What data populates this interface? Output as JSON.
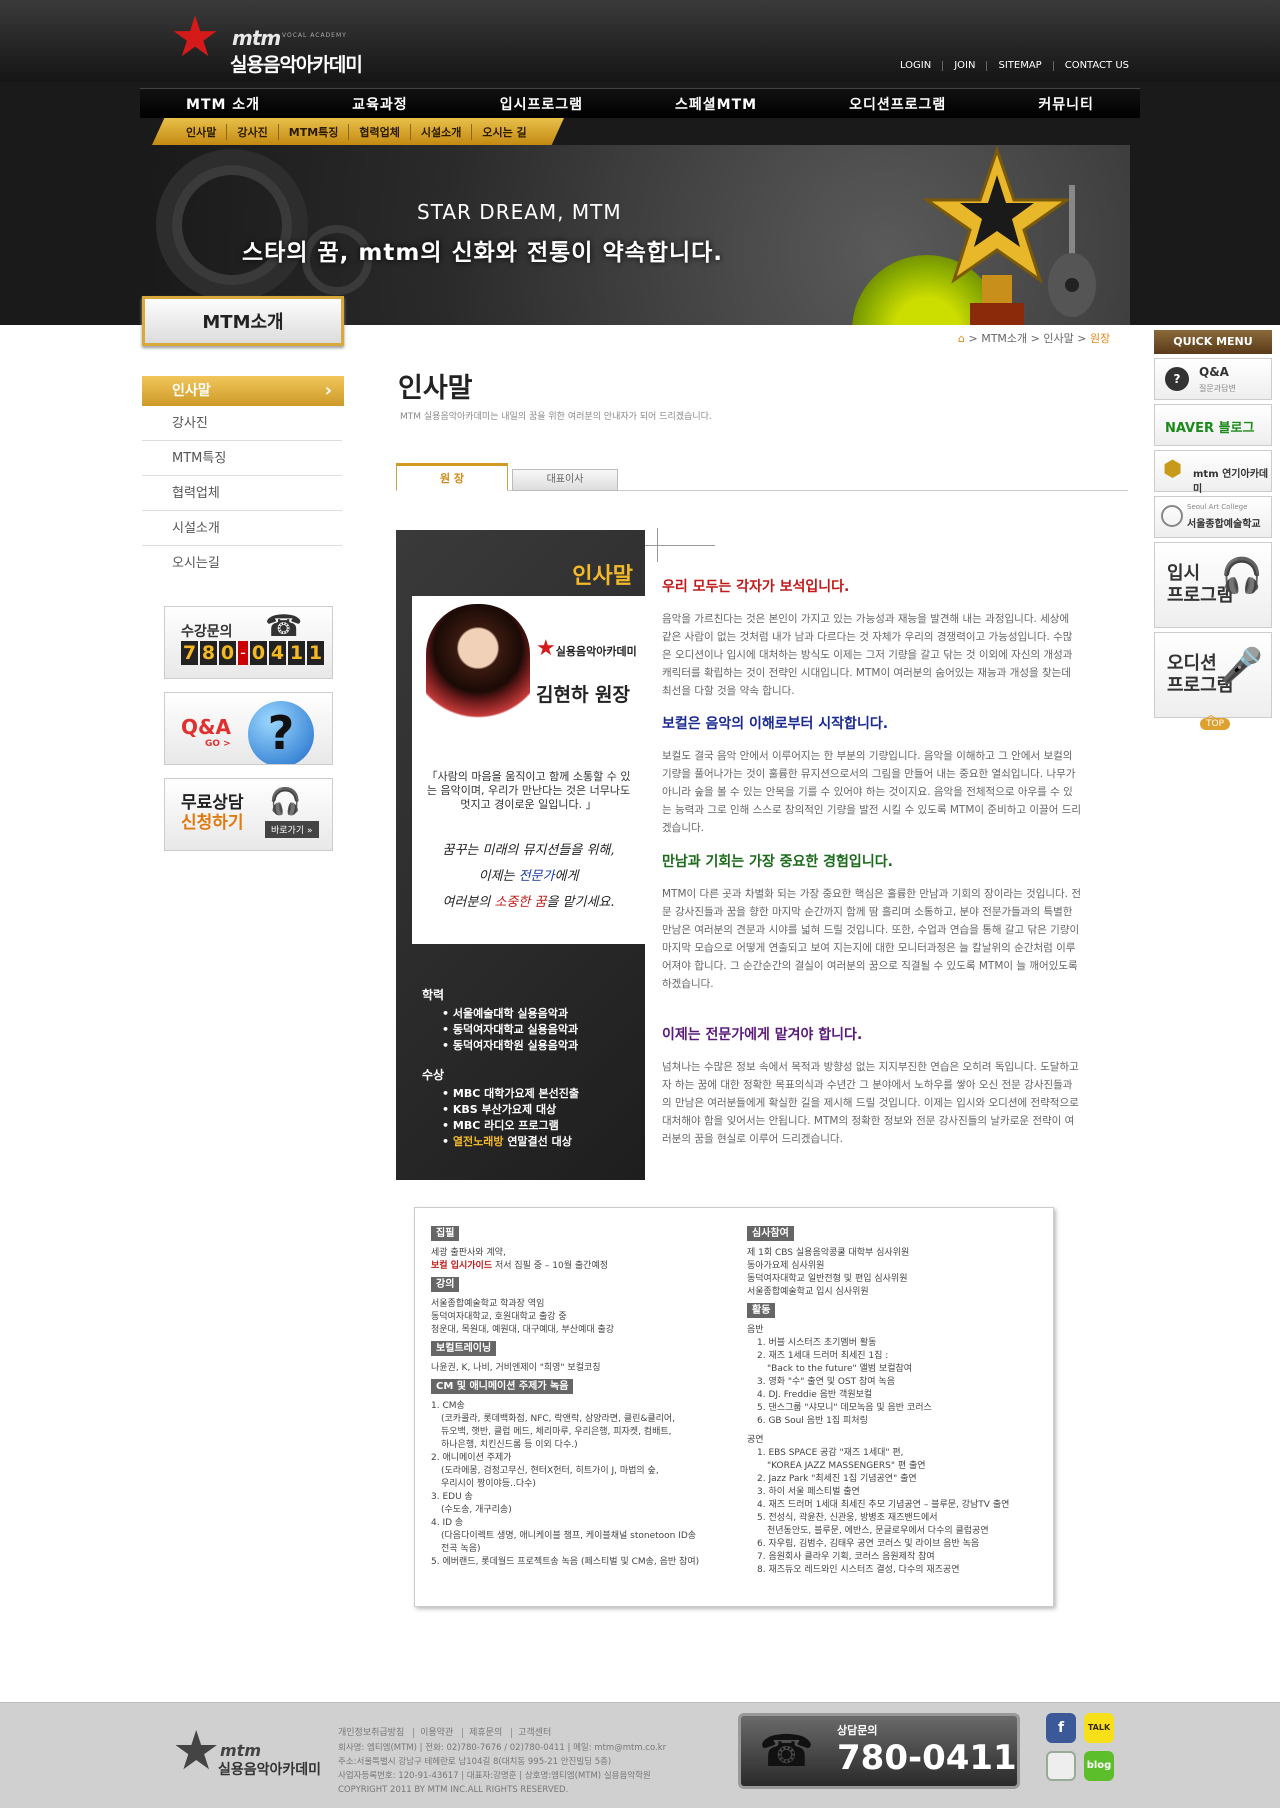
{
  "header": {
    "logo_mtm": "mtm",
    "logo_sub": "VOCAL ACADEMY",
    "logo_kr": "실용음악아카데미",
    "top_links": [
      "LOGIN",
      "JOIN",
      "SITEMAP",
      "CONTACT US"
    ],
    "gnb": [
      "MTM 소개",
      "교육과정",
      "입시프로그램",
      "스페셜MTM",
      "오디션프로그램",
      "커뮤니티"
    ],
    "subnav": [
      "인사말",
      "강사진",
      "MTM특징",
      "협력업체",
      "시설소개",
      "오시는 길"
    ],
    "banner_en": "STAR DREAM, MTM",
    "banner_kr": "스타의 꿈, mtm의 신화와 전통이 약속합니다."
  },
  "sidebar": {
    "title": "MTM소개",
    "items": [
      "인사말",
      "강사진",
      "MTM특징",
      "협력업체",
      "시설소개",
      "오시는길"
    ],
    "contact_label": "수강문의",
    "contact_num1": [
      "7",
      "8",
      "0"
    ],
    "contact_num2": [
      "0",
      "4",
      "1",
      "1"
    ],
    "qa_label": "Q&A",
    "qa_go": "GO >",
    "free_line1": "무료상담",
    "free_line2": "신청하기",
    "free_go": "바로가기 »"
  },
  "breadcrumb": {
    "items": [
      "MTM소개",
      "인사말"
    ],
    "current": "원장"
  },
  "content": {
    "title": "인사말",
    "desc": "MTM 실용음악아카데미는 내일의 꿈을 위한 여러분의 안내자가 되어 드리겠습니다.",
    "tab_active": "원 장",
    "tab_other": "대표이사"
  },
  "panel": {
    "title": "인사말",
    "logo_text": "실용음악아카데미",
    "name": "김현하 원장",
    "quote": "「사람의 마음을 움직이고 함께 소통할 수 있는 음악이며, 우리가 만난다는 것은 너무나도 멋지고 경이로운 일입니다. 」",
    "hand1": "꿈꾸는 미래의 뮤지션들을 위해,",
    "hand2a": "이제는 ",
    "hand2b": "전문가",
    "hand2c": "에게",
    "hand3a": "여러분의 ",
    "hand3b": "소중한 꿈",
    "hand3c": "을 맡기세요.",
    "edu_title": "학력",
    "edu": [
      "서울예술대학 실용음악과",
      "동덕여자대학교 실용음악과",
      "동덕여자대학원 실용음악과"
    ],
    "award_title": "수상",
    "awards": [
      "MBC 대학가요제 본선진출",
      "KBS 부산가요제 대상",
      "MBC 라디오 프로그램"
    ],
    "award_last_y": "열전노래방",
    "award_last": " 연말결선 대상"
  },
  "body": {
    "s1_title": "우리 모두는 각자가 보석입니다.",
    "s1_color": "#c01a1a",
    "s1_text": "음악을 가르친다는 것은 본인이 가지고 있는 가능성과 재능을 발견해 내는 과정입니다. 세상에 같은 사람이 없는 것처럼 내가 남과 다르다는 것 자체가 우리의 경쟁력이고 가능성입니다. 수많은 오디션이나 입시에 대처하는 방식도 이제는 그저 기량을 갈고 닦는 것 이외에 자신의 개성과 캐릭터를 확립하는 것이 전략인 시대입니다. MTM이 여러분의 숨어있는 재능과 개성을 찾는데 최선을 다할 것을 약속 합니다.",
    "s2_title": "보컬은 음악의 이해로부터 시작합니다.",
    "s2_color": "#1a2a90",
    "s2_text": "보컬도 결국 음악 안에서 이루어지는 한 부분의 기량입니다. 음악을 이해하고 그 안에서 보컬의 기량을 풀어나가는 것이 훌륭한 뮤지션으로서의 그림을 만들어 내는 중요한 열쇠입니다. 나무가 아니라 숲을 볼 수 있는 안목을 기를 수 있어야 하는 것이지요. 음악을 전체적으로 아우를 수 있는 능력과 그로 인해 스스로 창의적인 기량을 발전 시킬 수 있도록 MTM이 준비하고 이끌어 드리겠습니다.",
    "s3_title": "만남과 기회는 가장 중요한 경험입니다.",
    "s3_color": "#1a6a1a",
    "s3_text": "MTM이 다른 곳과 차별화 되는 가장 중요한 핵심은 훌륭한 만남과 기회의 장이라는 것입니다. 전문 강사진들과 꿈을 향한 마지막 순간까지 함께 땀 흘리며 소통하고, 분야 전문가들과의 특별한 만남은 여러분의 견문과 시야를 넓혀 드릴 것입니다. 또한, 수업과 연습을 통해 갈고 닦은 기량이 마지막 모습으로 어떻게 연출되고 보여 지는지에 대한 모니터과정은 늘 칼날위의 순간처럼 이루어져야 합니다. 그 순간순간의 결실이 여러분의 꿈으로 직결될 수 있도록 MTM이 늘 깨어있도록 하겠습니다.",
    "s4_title": "이제는 전문가에게 맡겨야 합니다.",
    "s4_color": "#5a1a7a",
    "s4_text": "넘쳐나는 수많은 정보 속에서 목적과 방향성 없는 지지부진한 연습은 오히려 독입니다. 도달하고자 하는 꿈에 대한 정확한 목표의식과 수년간 그 분야에서 노하우를 쌓아 오신 전문 강사진들과의 만남은 여러분들에게 확실한 길을 제시해 드릴 것입니다. 이제는 입시와 오디션에 전략적으로 대처해야 함을 잊어서는 안됩니다. MTM의 정확한 정보와 전문 강사진들의 날카로운 전략이 여러분의 꿈을 현실로 이루어 드리겠습니다."
  },
  "history": {
    "l1": "집필",
    "l1_text1": "세광 출판사와 계약,",
    "l1_red": "보컬 입시가이드",
    "l1_text2": " 저서 집필 중 – 10월 출간예정",
    "l2": "강의",
    "l2_lines": [
      "서울종합예술학교 학과장 역임",
      "동덕여자대학교, 호원대학교 출강 중",
      "청운대, 목원대, 예원대, 대구예대, 부산예대 출강"
    ],
    "l3": "보컬트레이닝",
    "l3_text": "나윤권, K, 나비, 거비엔제이 \"희영\" 보컬코칭",
    "l4": "CM 및 애니메이션 주제가 녹음",
    "l4_lines": [
      "1. CM송",
      "(코카콜라, 롯데백화점, NFC, 락앤락, 삼양라면, 클린&클리어,",
      "듀오백, 햇반, 클럽 메드, 체리마루, 우리은행, 피자켓, 컴배트,",
      "하나은행, 치킨신드롬 등 이외 다수.)",
      "2. 애니메이션 주제가",
      "(도라에몽, 검정고무신, 현터X헌터, 히트가이 J, 마법의 숲,",
      "우리시이 짱이야등..다수)",
      "3. EDU 송",
      "(수도송, 개구리송)",
      "4. ID 송",
      "(다음다이렉트 생명, 애니케이블 챔프, 케이블채널 stonetoon ID송",
      "전곡 녹음)",
      "5. 에버랜드, 롯데월드 프로젝트송 녹음 (페스티벌 및 CM송, 음반 참여)"
    ],
    "r1": "심사참여",
    "r1_lines": [
      "제 1회 CBS 실용음악콩쿨 대학부 심사위원",
      "동아가요제 심사위원",
      "동덕여자대학교 일반전형 및 편입 심사위원",
      "서울종합예술학교 입시 심사위원"
    ],
    "r2": "활동",
    "r2_sub1": "음반",
    "r2_album": [
      "1. 버블 시스터즈 초기멤버 활동",
      "2. 재즈 1세대 드러머 최세진 1집 :",
      "\"Back to the future\" 앨범 보컬참여",
      "3. 영화 \"수\" 출연 및 OST 참여 녹음",
      "4. DJ. Freddie 음반 객원보컬",
      "5. 댄스그룹 \"샤모니\" 데모녹음 및 음반 코러스",
      "6. GB Soul 음반 1집 피처링"
    ],
    "r2_sub2": "공연",
    "r2_perf": [
      "1. EBS SPACE 공감 \"재즈 1세대\" 편,",
      "\"KOREA JAZZ MASSENGERS\" 편 출연",
      "2. Jazz Park \"최세진 1집 기념공연\" 출연",
      "3. 하이 서울 페스티벌 출연",
      "4. 재즈 드러머 1세대 최세진 추모 기념공연 – 블루문, 강남TV 출연",
      "5. 전성식, 곽윤찬, 신관웅, 방병조 재즈밴드에서",
      "천년동안도, 블루문, 에반스, 문글로우에서 다수의 클럽공연",
      "6. 자우림, 김범수, 김태우 공연 코러스 및 라이브 음반 녹음",
      "7. 음원회사 클라우 기획, 코러스 음원제작 참여",
      "8. 재즈듀오 레드와인 시스터즈 결성, 다수의 재즈공연"
    ]
  },
  "quickmenu": {
    "title": "QUICK MENU",
    "qa": "Q&A",
    "qa_sub": "질문과답변",
    "naver": "NAVER 블로그",
    "mtm_acting": "mtm 연기아카데미",
    "seoul_art_en": "Seoul Art College",
    "seoul_art": "서울종합예술학교",
    "exam1": "입시",
    "exam2": "프로그램",
    "aud1": "오디션",
    "aud2": "프로그램",
    "top": "TOP"
  },
  "footer": {
    "logo_mtm": "mtm",
    "logo_kr": "실용음악아카데미",
    "links": [
      "개인정보취급방침",
      "이용약관",
      "제휴문의",
      "고객센터"
    ],
    "info": [
      "회사명: 엠티엠(MTM) | 전화: 02)780-7676 / 02)780-0411 | 메일: mtm@mtm.co.kr",
      "주소:서울특별시 강남구 테헤란로 남104길 8(대치동 995-21 안진빌딩 5층)",
      "사업자등록번호: 120-91-43617 | 대표자:강명훈 | 상호명:엠티엠(MTM) 실용음악학원",
      "COPYRIGHT 2011 BY MTM INC.ALL RIGHTS RESERVED."
    ],
    "call_label": "상담문의",
    "call_num": "780-0411",
    "sns": [
      "f",
      "TALK",
      "",
      "blog"
    ]
  }
}
